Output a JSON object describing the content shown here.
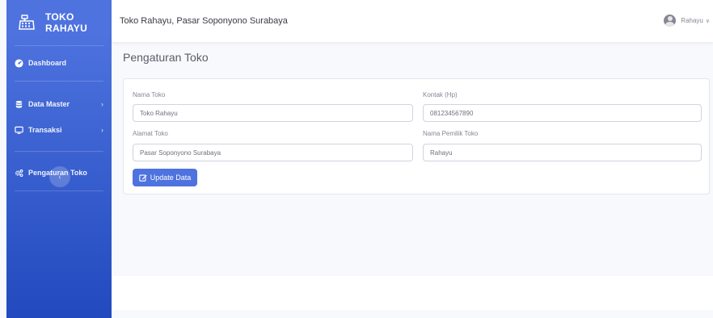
{
  "sidebar": {
    "brand": "TOKO RAHAYU",
    "items": [
      {
        "label": "Dashboard"
      },
      {
        "label": "Data Master"
      },
      {
        "label": "Transaksi"
      },
      {
        "label": "Pengaturan Toko"
      }
    ],
    "toggle_glyph": "‹"
  },
  "topbar": {
    "title": "Toko Rahayu, Pasar Soponyono Surabaya",
    "user": "Rahayu"
  },
  "page": {
    "title": "Pengaturan Toko"
  },
  "form": {
    "nama_toko_label": "Nama Toko",
    "nama_toko_value": "Toko Rahayu",
    "kontak_label": "Kontak (Hp)",
    "kontak_value": "081234567890",
    "alamat_label": "Alamat Toko",
    "alamat_value": "Pasar Soponyono Surabaya",
    "pemilik_label": "Nama Pemilik Toko",
    "pemilik_value": "Rahayu",
    "submit_label": "Update Data"
  },
  "colors": {
    "primary": "#4e73df",
    "primary_dark": "#224abe",
    "text": "#5a5c69",
    "muted": "#858796"
  }
}
